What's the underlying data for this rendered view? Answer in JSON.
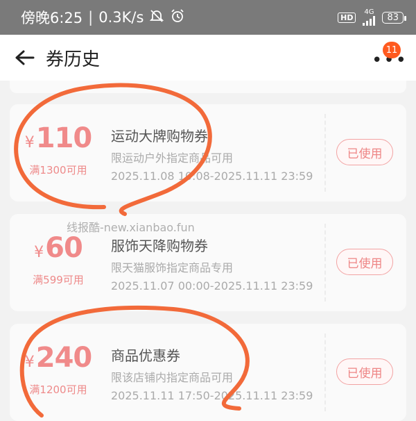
{
  "status_bar": {
    "time": "傍晚6:25",
    "separator": "|",
    "network_speed": "0.3K/s",
    "hd": "HD",
    "network_type": "4G",
    "battery": "83"
  },
  "header": {
    "title": "券历史",
    "badge_count": "11"
  },
  "coupons": [
    {
      "currency": "¥",
      "amount": "110",
      "threshold": "满1300可用",
      "title": "运动大牌购物券",
      "description": "限运动户外指定商品可用",
      "period": "2025.11.08 10:08-2025.11.11 23:59",
      "status": "已使用"
    },
    {
      "currency": "¥",
      "amount": "60",
      "threshold": "满599可用",
      "title": "服饰天降购物券",
      "description": "限天猫服饰指定商品专用",
      "period": "2025.11.07 00:00-2025.11.11 23:59",
      "status": "已使用"
    },
    {
      "currency": "¥",
      "amount": "240",
      "threshold": "满1200可用",
      "title": "商品优惠券",
      "description": "限该店铺内指定商品可用",
      "period": "2025.11.11 17:50-2025.11.11 23:59",
      "status": "已使用"
    }
  ],
  "watermark": "线报酷-new.xianbao.fun",
  "colors": {
    "status_bar_bg": "#7a7a7a",
    "accent_red": "#ee8585",
    "badge_orange": "#ff5a1f",
    "scribble_orange": "#f26a3a"
  }
}
